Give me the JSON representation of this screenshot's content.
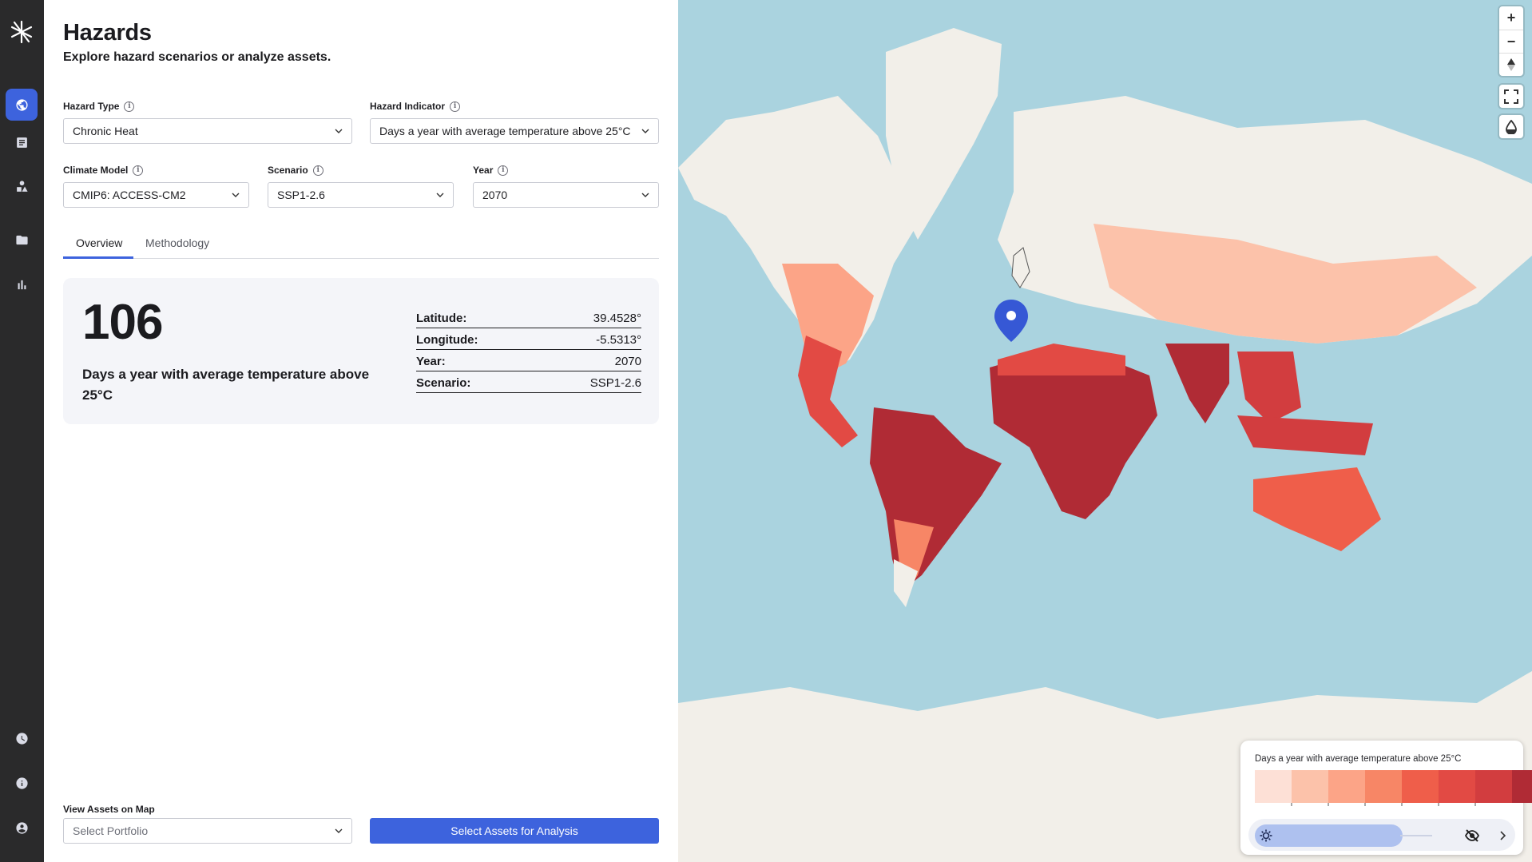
{
  "sidebar": {
    "items": [
      {
        "icon": "globe-icon",
        "active": true
      },
      {
        "icon": "document-icon",
        "active": false
      },
      {
        "icon": "shapes-icon",
        "active": false
      },
      {
        "icon": "folder-icon",
        "active": false
      },
      {
        "icon": "bar-chart-icon",
        "active": false
      },
      {
        "icon": "clock-icon",
        "active": false
      },
      {
        "icon": "info-icon",
        "active": false
      },
      {
        "icon": "account-icon",
        "active": false
      }
    ]
  },
  "header": {
    "title": "Hazards",
    "subtitle": "Explore hazard scenarios or analyze assets."
  },
  "filters": {
    "hazard_type": {
      "label": "Hazard Type",
      "value": "Chronic Heat"
    },
    "hazard_indicator": {
      "label": "Hazard Indicator",
      "value": "Days a year with average temperature above 25°C"
    },
    "climate_model": {
      "label": "Climate Model",
      "value": "CMIP6: ACCESS-CM2"
    },
    "scenario": {
      "label": "Scenario",
      "value": "SSP1-2.6"
    },
    "year": {
      "label": "Year",
      "value": "2070"
    }
  },
  "tabs": [
    {
      "label": "Overview",
      "active": true
    },
    {
      "label": "Methodology",
      "active": false
    }
  ],
  "result": {
    "value": "106",
    "description": "Days a year with average temperature above 25°C",
    "details": [
      {
        "key": "Latitude:",
        "value": "39.4528°"
      },
      {
        "key": "Longitude:",
        "value": "-5.5313°"
      },
      {
        "key": "Year:",
        "value": "2070"
      },
      {
        "key": "Scenario:",
        "value": "SSP1-2.6"
      }
    ]
  },
  "footer": {
    "view_assets_label": "View Assets on Map",
    "portfolio_placeholder": "Select Portfolio",
    "select_assets_button": "Select Assets for Analysis"
  },
  "map": {
    "legend_title": "Days a year with average temperature above 25°C",
    "legend_colors": [
      "#fde0d6",
      "#fcc2aa",
      "#fca487",
      "#f78666",
      "#ef5e4a",
      "#e24a44",
      "#d23d3f",
      "#b02b35"
    ],
    "zoom_in": "+",
    "zoom_out": "−",
    "colors": {
      "ocean": "#aad3df",
      "land": "#f2efe9",
      "accent": "#3d63dd",
      "marker": "#3658d5"
    }
  }
}
